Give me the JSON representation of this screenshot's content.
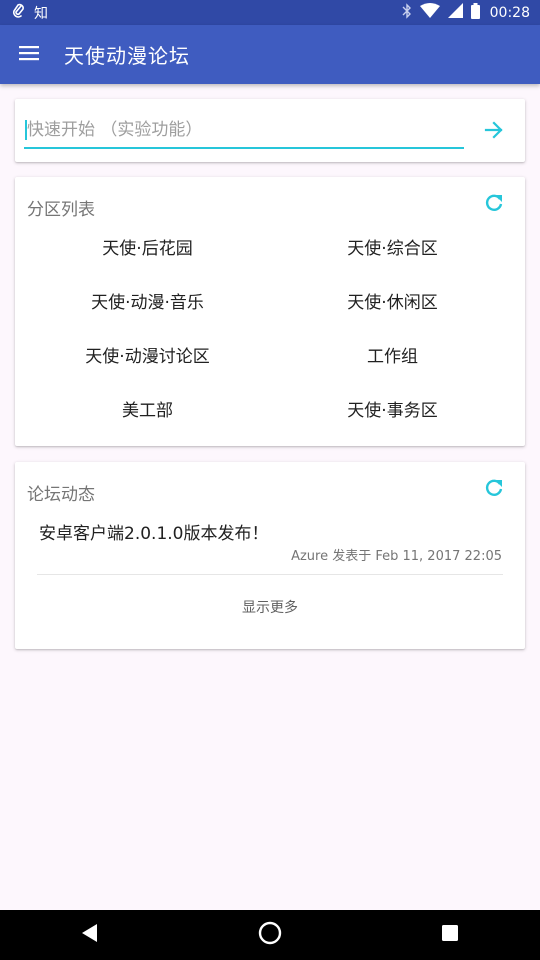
{
  "status_bar": {
    "left_text": "知",
    "time": "00:28",
    "icons": [
      "clip-icon",
      "bluetooth-icon",
      "wifi-icon",
      "signal-icon",
      "battery-icon"
    ]
  },
  "app_bar": {
    "title": "天使动漫论坛",
    "menu_icon": "hamburger-menu-icon"
  },
  "quick_start": {
    "placeholder": "快速开始 （实验功能）",
    "value": "",
    "submit_icon": "arrow-right-icon"
  },
  "sections": {
    "header": "分区列表",
    "refresh_icon": "refresh-icon",
    "items": [
      {
        "label": "天使·后花园"
      },
      {
        "label": "天使·综合区"
      },
      {
        "label": "天使·动漫·音乐"
      },
      {
        "label": "天使·休闲区"
      },
      {
        "label": "天使·动漫讨论区"
      },
      {
        "label": "工作组"
      },
      {
        "label": "美工部"
      },
      {
        "label": "天使·事务区"
      }
    ]
  },
  "news": {
    "header": "论坛动态",
    "refresh_icon": "refresh-icon",
    "items": [
      {
        "title": "安卓客户端2.0.1.0版本发布！",
        "meta": "Azure 发表于 Feb 11, 2017 22:05"
      }
    ],
    "show_more": "显示更多"
  },
  "nav_bar": {
    "icons": [
      "back-icon",
      "home-icon",
      "recents-icon"
    ]
  },
  "colors": {
    "status_bar": "#3049a6",
    "app_bar": "#3f5cc0",
    "accent": "#26c6da",
    "background": "#fdf7fd"
  }
}
